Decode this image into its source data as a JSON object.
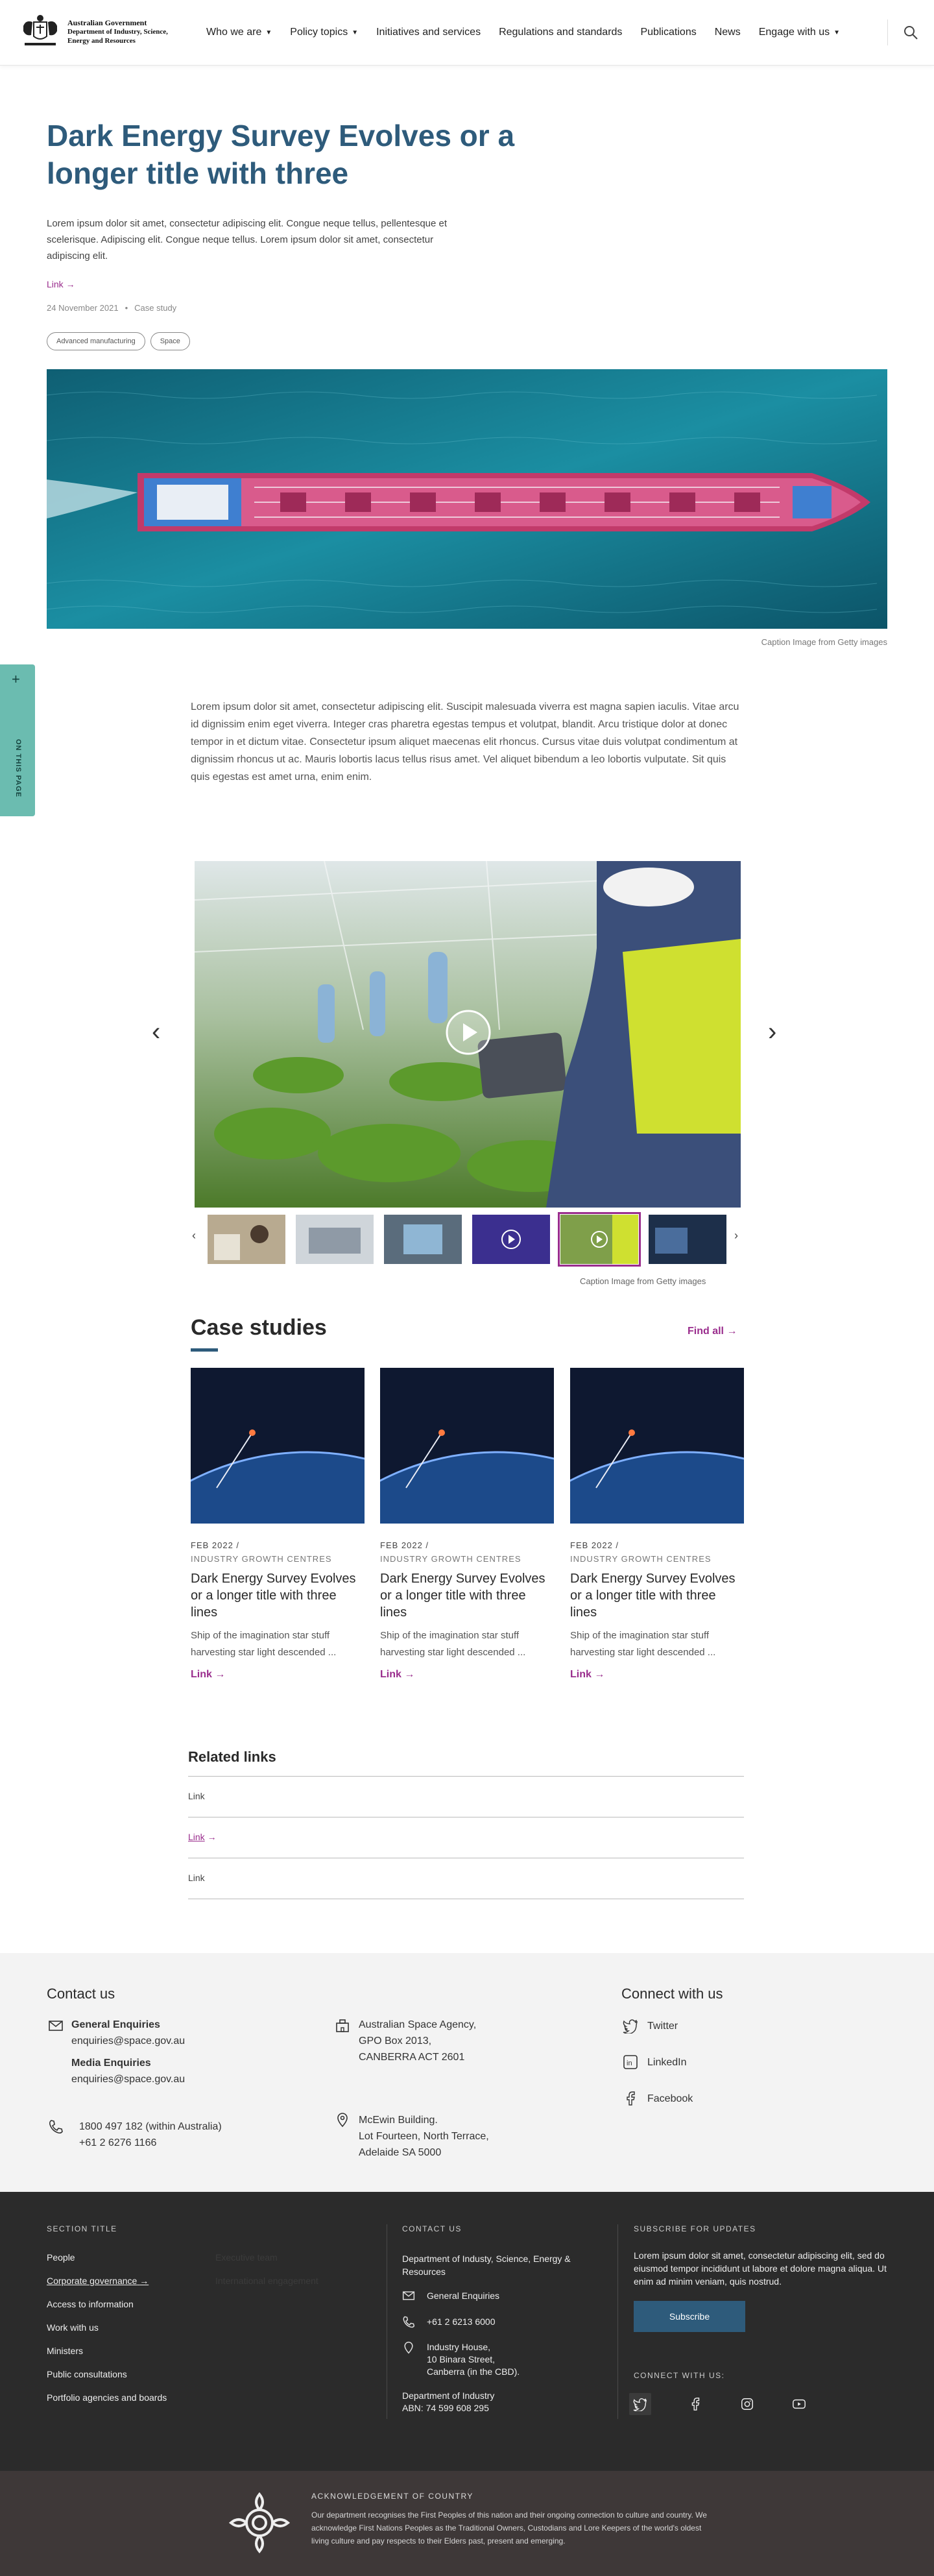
{
  "header": {
    "logo_line1": "Australian Government",
    "logo_line2": "Department of Industry, Science,",
    "logo_line3": "Energy and Resources",
    "nav": [
      {
        "label": "Who we are",
        "has_caret": true
      },
      {
        "label": "Policy topics",
        "has_caret": true
      },
      {
        "label": "Initiatives and services",
        "has_caret": false
      },
      {
        "label": "Regulations and standards",
        "has_caret": false
      },
      {
        "label": "Publications",
        "has_caret": false
      },
      {
        "label": "News",
        "has_caret": false
      },
      {
        "label": "Engage with us",
        "has_caret": true
      }
    ],
    "search_icon": "search-icon"
  },
  "hero": {
    "title": "Dark Energy Survey Evolves or a longer title with three",
    "lead": "Lorem ipsum dolor sit amet, consectetur adipiscing elit. Congue neque tellus, pellentesque et scelerisque. Adipiscing elit. Congue neque tellus. Lorem ipsum dolor sit amet, consectetur adipiscing elit.",
    "link": "Link",
    "date": "24 November 2021",
    "separator": "•",
    "type": "Case study",
    "tags": [
      "Advanced manufacturing",
      "Space"
    ],
    "caption": "Caption Image from Getty images"
  },
  "side_tab": {
    "label": "ON THIS PAGE",
    "icon": "plus-icon"
  },
  "body_text": "Lorem ipsum dolor sit amet, consectetur adipiscing elit. Suscipit malesuada viverra est magna sapien iaculis. Vitae arcu id dignissim enim eget viverra. Integer cras pharetra egestas tempus et volutpat, blandit. Arcu tristique dolor at donec tempor in et dictum vitae. Consectetur ipsum aliquet maecenas elit rhoncus. Cursus vitae duis volutpat condimentum at dignissim rhoncus ut ac. Mauris lobortis lacus tellus risus amet. Vel aliquet bibendum a leo lobortis vulputate. Sit quis quis egestas est amet urna, enim enim.",
  "carousel": {
    "caption": "Caption Image from Getty images",
    "selected_index": 4,
    "thumb_count": 6
  },
  "case_studies": {
    "heading": "Case studies",
    "find_all": "Find all",
    "cards": [
      {
        "date": "FEB 2022 /",
        "org": "INDUSTRY GROWTH CENTRES",
        "title": "Dark Energy Survey Evolves or a longer title with three lines",
        "desc": "Ship of the imagination star stuff harvesting star light descended ...",
        "link": "Link"
      },
      {
        "date": "FEB 2022 /",
        "org": "INDUSTRY GROWTH CENTRES",
        "title": "Dark Energy Survey Evolves or a longer title with three lines",
        "desc": "Ship of the imagination star stuff harvesting star light descended ...",
        "link": "Link"
      },
      {
        "date": "FEB 2022 /",
        "org": "INDUSTRY GROWTH CENTRES",
        "title": "Dark Energy Survey Evolves or a longer title with three lines",
        "desc": "Ship of the imagination star stuff harvesting star light descended ...",
        "link": "Link"
      }
    ]
  },
  "related_links": {
    "heading": "Related links",
    "items": [
      "Link",
      "Link",
      "Link"
    ]
  },
  "contact": {
    "title": "Contact us",
    "general_label": "General Enquiries",
    "general_email": "enquiries@space.gov.au",
    "media_label": "Media Enquiries",
    "media_email": "enquiries@space.gov.au",
    "phone1": "1800 497 182 (within Australia)",
    "phone2": "+61 2 6276 1166",
    "addr1_line1": "Australian Space Agency,",
    "addr1_line2": "GPO Box 2013,",
    "addr1_line3": "CANBERRA ACT 2601",
    "addr2_line1": "McEwin Building.",
    "addr2_line2": "Lot Fourteen, North Terrace,",
    "addr2_line3": "Adelaide SA 5000",
    "connect_title": "Connect with us",
    "twitter": "Twitter",
    "linkedin": "LinkedIn",
    "facebook": "Facebook"
  },
  "footer": {
    "section_title": "SECTION TITLE",
    "links": [
      "People",
      "Corporate governance",
      "Access to information",
      "Work with us",
      "Ministers",
      "Public consultations",
      "Portfolio agencies and boards"
    ],
    "faded_links": [
      "Executive team",
      "International engagement"
    ],
    "contact_label": "CONTACT US",
    "dept": "Department of Industy, Science, Energy & Resources",
    "general": "General Enquiries",
    "phone": "+61 2 6213 6000",
    "addr_line1": "Industry House,",
    "addr_line2": "10 Binara Street,",
    "addr_line3": "Canberra (in the CBD).",
    "abn_line1": "Department of Industry",
    "abn_line2": "ABN: 74 599 608 295",
    "subscribe_label": "SUBSCRIBE FOR UPDATES",
    "subscribe_text": "Lorem ipsum dolor sit amet, consectetur adipiscing elit, sed do eiusmod tempor incididunt ut labore et dolore magna aliqua. Ut enim ad minim veniam, quis nostrud.",
    "subscribe_button": "Subscribe",
    "connect_label": "CONNECT WITH US:"
  },
  "acknowledgement": {
    "title": "ACKNOWLEDGEMENT OF COUNTRY",
    "text": "Our department recognises the First Peoples of this nation and their ongoing connection to culture and country. We acknowledge First Nations Peoples as the Traditional Owners, Custodians and Lore Keepers of the world's oldest living culture and pay respects to their Elders past, present and emerging."
  },
  "colors": {
    "accent_purple": "#9a2d8d",
    "heading_blue": "#2e5b7b",
    "teal_tab": "#6bbcb0",
    "footer_bg": "#2b2b2b"
  }
}
